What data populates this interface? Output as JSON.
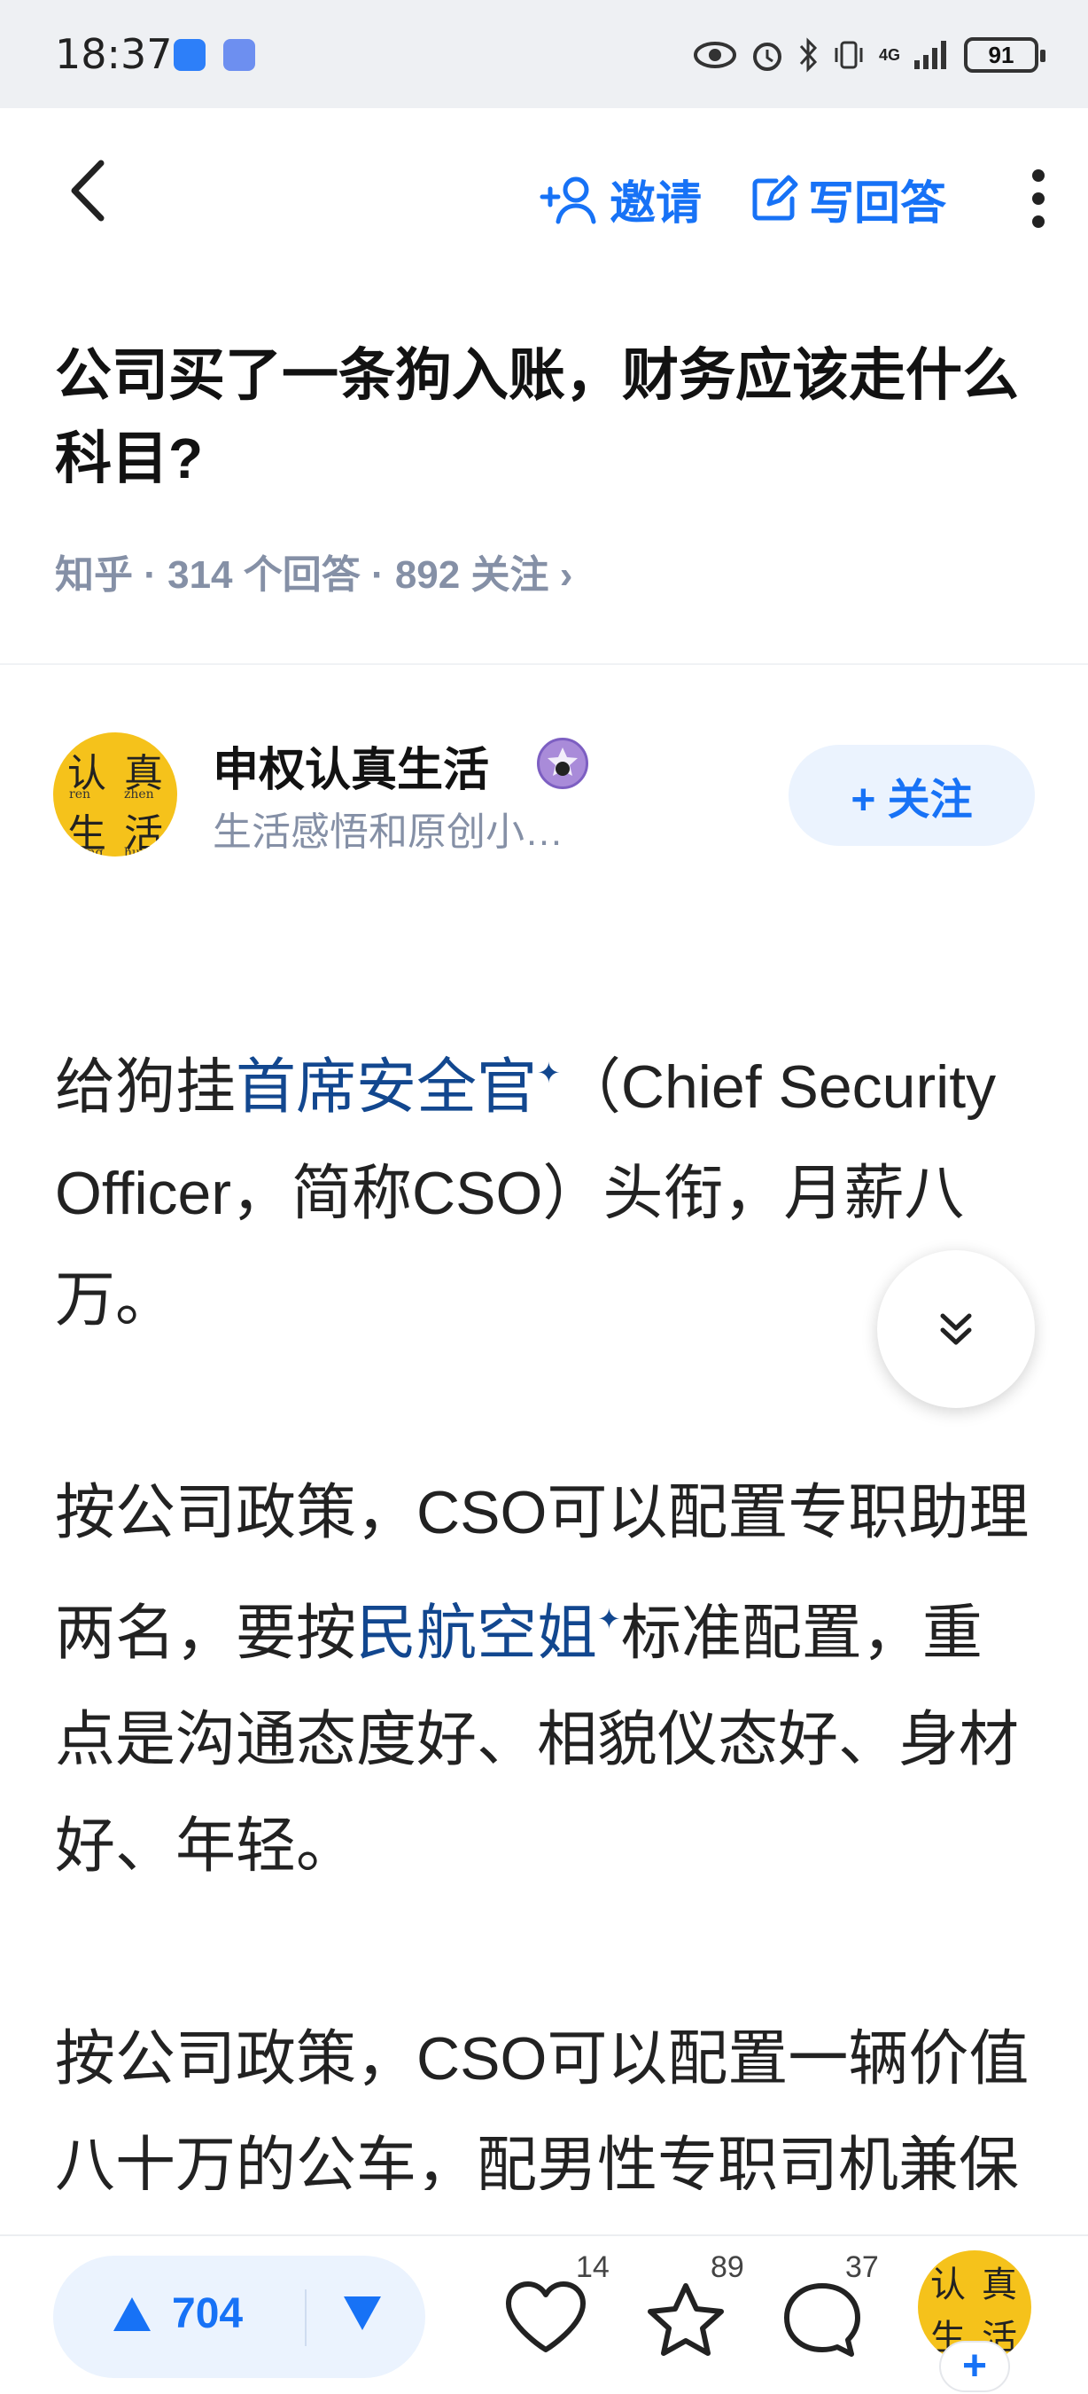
{
  "status_bar": {
    "time": "18:37",
    "network": "4G",
    "battery": "91"
  },
  "nav": {
    "invite_label": "邀请",
    "write_answer_label": "写回答"
  },
  "question": {
    "title": "公司买了一条狗入账，财务应该走什么科目?",
    "meta": "知乎 · 314 个回答 · 892 关注 ›"
  },
  "author": {
    "name": "申权认真生活",
    "bio": "生活感悟和原创小…",
    "follow_label": "+ 关注",
    "avatar_chars": [
      "认",
      "真",
      "生",
      "活"
    ],
    "avatar_pinyin": [
      "ren",
      "zhen",
      "sheng",
      "huo"
    ]
  },
  "content": {
    "p1_a": "给狗挂",
    "p1_link": "首席安全官",
    "p1_b": "（Chief Security Officer，简称CSO）头衔，月薪八万。",
    "p2_a": "按公司政策，CSO可以配置专职助理两名，要按",
    "p2_link": "民航空姐",
    "p2_b": "标准配置，重点是沟通态度好、相貌仪态好、身材好、年轻。",
    "p3": "按公司政策，CSO可以配置一辆价值八十万的公车，配男性专职司机兼保镖一名，寸步不离CSO。"
  },
  "bottom_bar": {
    "upvotes": "704",
    "likes": "14",
    "favorites": "89",
    "comments": "37"
  },
  "colors": {
    "accent": "#1772f6",
    "link": "#12478f",
    "meta": "#8590a6",
    "avatar_bg": "#f5c21b"
  }
}
